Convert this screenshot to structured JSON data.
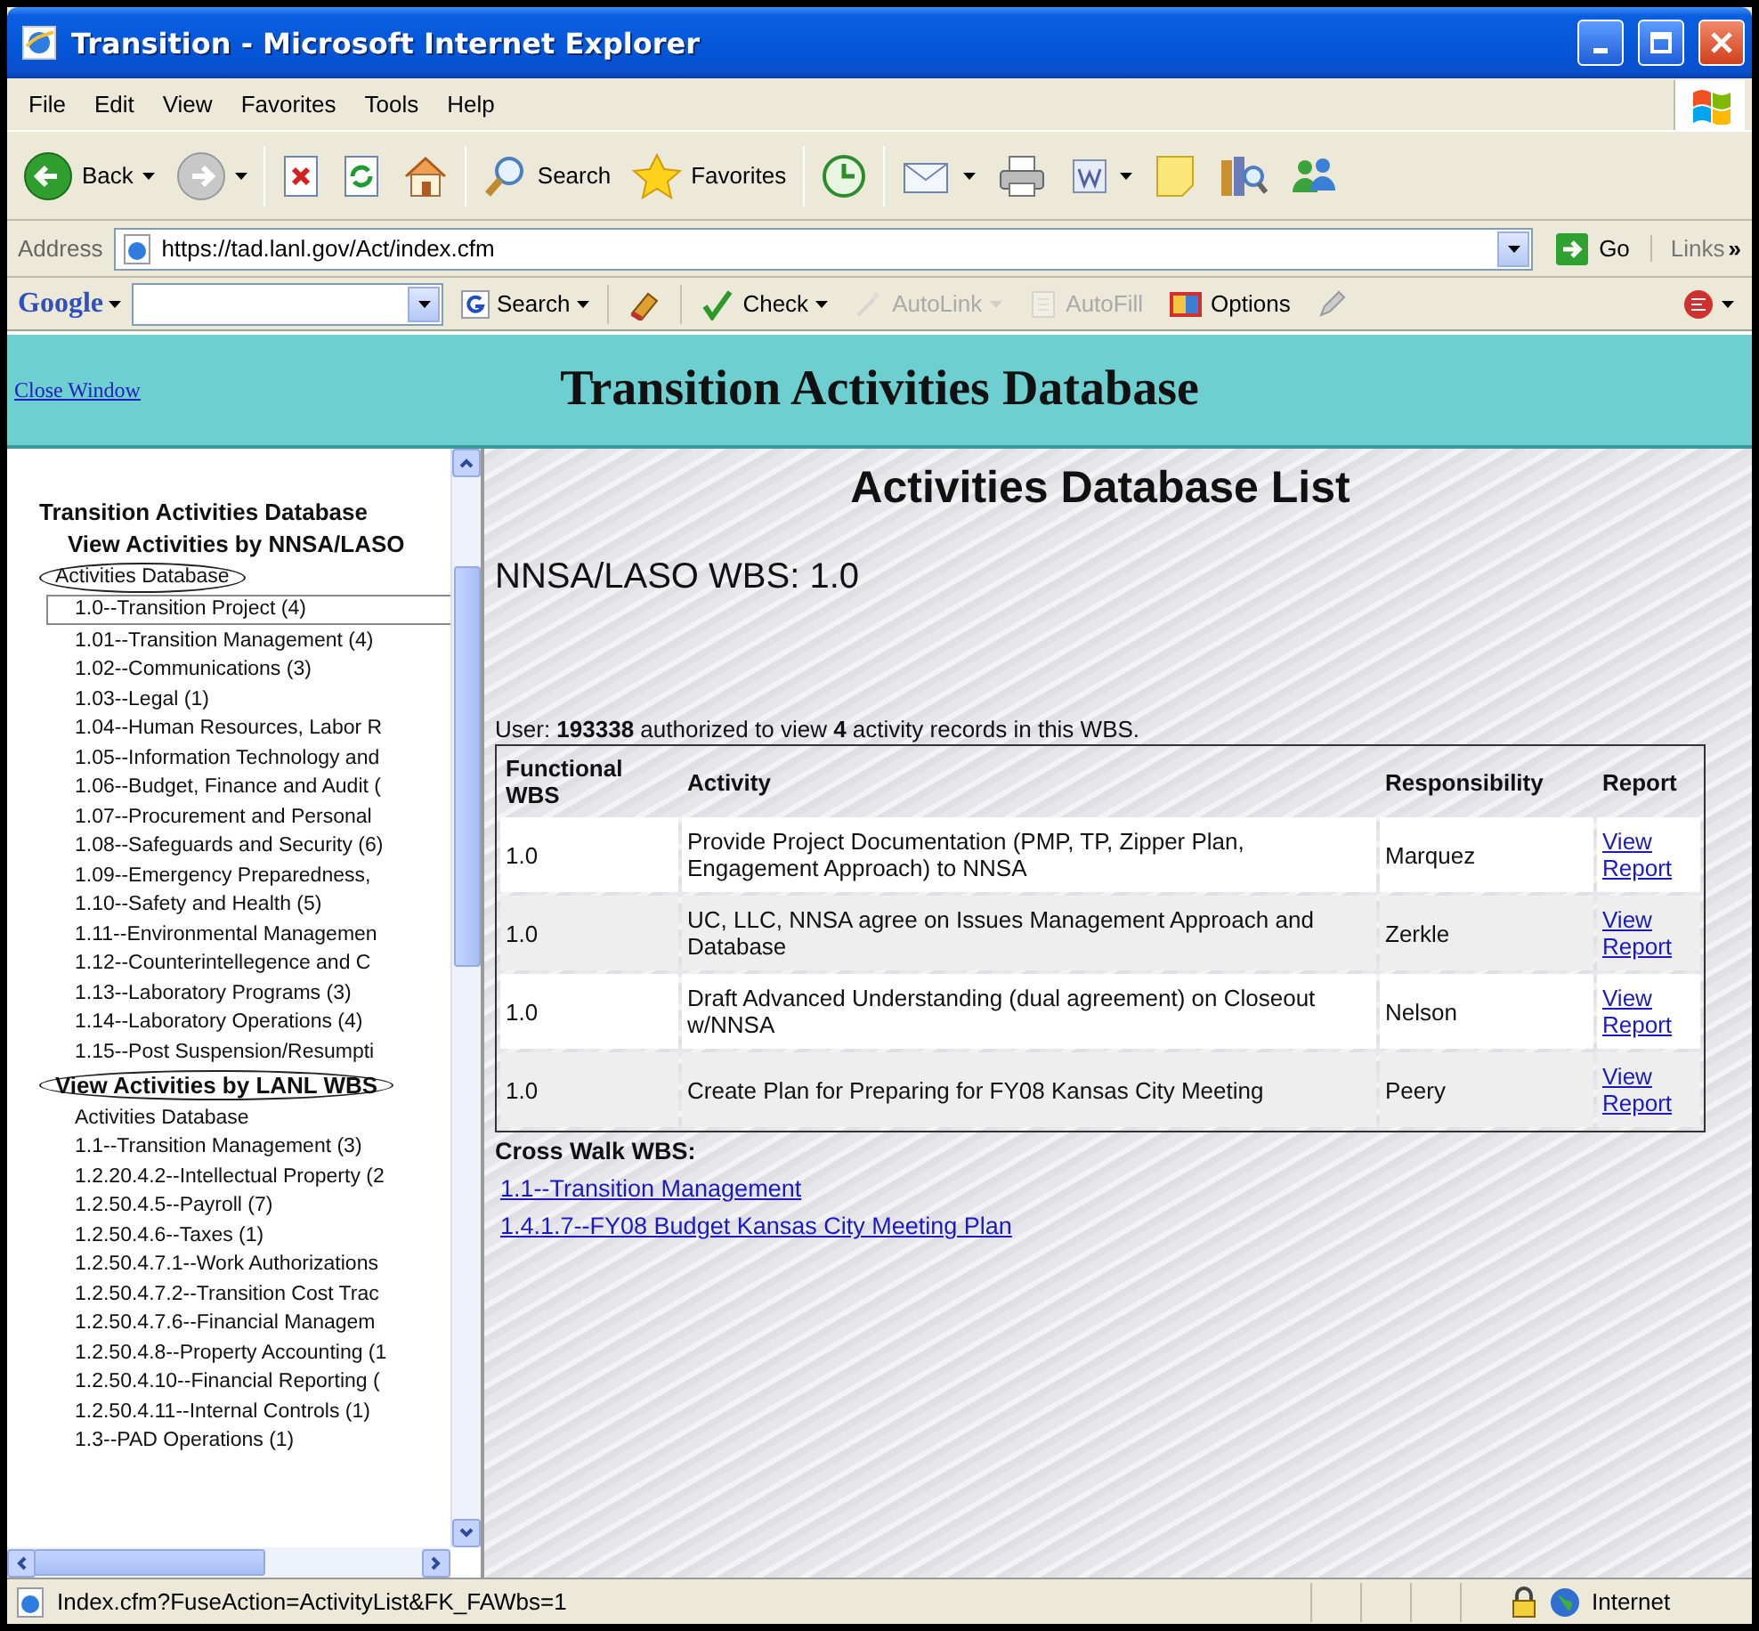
{
  "window": {
    "title": "Transition - Microsoft Internet Explorer"
  },
  "menu": [
    "File",
    "Edit",
    "View",
    "Favorites",
    "Tools",
    "Help"
  ],
  "toolbar": [
    {
      "label": "Back",
      "dropdown": true
    },
    {
      "dropdown": true
    },
    {
      "dropdown": false
    },
    {
      "dropdown": false
    },
    {
      "dropdown": false
    },
    {
      "label": "Search",
      "dropdown": false
    },
    {
      "label": "Favorites",
      "dropdown": false
    },
    {
      "dropdown": false
    },
    {
      "dropdown": true
    },
    {
      "dropdown": false
    },
    {
      "dropdown": true
    },
    {
      "dropdown": false
    },
    {
      "dropdown": false
    },
    {
      "dropdown": false
    }
  ],
  "address": {
    "label": "Address",
    "url": "https://tad.lanl.gov/Act/index.cfm",
    "go": "Go",
    "links": "Links",
    "more": "»"
  },
  "google_bar": {
    "logo": "Google",
    "buttons": [
      {
        "label": "Search",
        "dropdown": true,
        "disabled": false
      },
      {
        "dropdown": false,
        "disabled": false
      },
      {
        "label": "Check",
        "dropdown": true,
        "disabled": false
      },
      {
        "label": "AutoLink",
        "dropdown": true,
        "disabled": true
      },
      {
        "label": "AutoFill",
        "dropdown": false,
        "disabled": true
      },
      {
        "label": "Options",
        "dropdown": false,
        "disabled": false
      },
      {
        "dropdown": false,
        "disabled": false
      }
    ],
    "extra": {
      "dropdown": true
    }
  },
  "header": {
    "close_link": "Close Window",
    "title": "Transition Activities Database"
  },
  "sidebar": {
    "title": "Transition Activities Database",
    "sections": [
      {
        "heading": "View Activities by NNSA/LASO",
        "circled": false,
        "items": [
          {
            "label": "Activities Database",
            "selected": false,
            "circled": true
          },
          {
            "label": "1.0--Transition Project (4)",
            "selected": true,
            "circled": false
          },
          {
            "label": "1.01--Transition Management (4)",
            "selected": false,
            "circled": false
          },
          {
            "label": "1.02--Communications (3)",
            "selected": false,
            "circled": false
          },
          {
            "label": "1.03--Legal (1)",
            "selected": false,
            "circled": false
          },
          {
            "label": "1.04--Human Resources, Labor R",
            "selected": false,
            "circled": false
          },
          {
            "label": "1.05--Information Technology and",
            "selected": false,
            "circled": false
          },
          {
            "label": "1.06--Budget, Finance and Audit (",
            "selected": false,
            "circled": false
          },
          {
            "label": "1.07--Procurement and Personal",
            "selected": false,
            "circled": false
          },
          {
            "label": "1.08--Safeguards and Security (6)",
            "selected": false,
            "circled": false
          },
          {
            "label": "1.09--Emergency Preparedness,",
            "selected": false,
            "circled": false
          },
          {
            "label": "1.10--Safety and Health (5)",
            "selected": false,
            "circled": false
          },
          {
            "label": "1.11--Environmental Managemen",
            "selected": false,
            "circled": false
          },
          {
            "label": "1.12--Counterintellegence and C",
            "selected": false,
            "circled": false
          },
          {
            "label": "1.13--Laboratory Programs (3)",
            "selected": false,
            "circled": false
          },
          {
            "label": "1.14--Laboratory Operations (4)",
            "selected": false,
            "circled": false
          },
          {
            "label": "1.15--Post Suspension/Resumpti",
            "selected": false,
            "circled": false
          }
        ]
      },
      {
        "heading": "View Activities by LANL WBS",
        "circled": true,
        "items": [
          {
            "label": "Activities Database",
            "selected": false,
            "circled": false
          },
          {
            "label": "1.1--Transition Management (3)",
            "selected": false,
            "circled": false
          },
          {
            "label": "1.2.20.4.2--Intellectual Property (2",
            "selected": false,
            "circled": false
          },
          {
            "label": "1.2.50.4.5--Payroll (7)",
            "selected": false,
            "circled": false
          },
          {
            "label": "1.2.50.4.6--Taxes (1)",
            "selected": false,
            "circled": false
          },
          {
            "label": "1.2.50.4.7.1--Work Authorizations",
            "selected": false,
            "circled": false
          },
          {
            "label": "1.2.50.4.7.2--Transition Cost Trac",
            "selected": false,
            "circled": false
          },
          {
            "label": "1.2.50.4.7.6--Financial Managem",
            "selected": false,
            "circled": false
          },
          {
            "label": "1.2.50.4.8--Property Accounting (1",
            "selected": false,
            "circled": false
          },
          {
            "label": "1.2.50.4.10--Financial Reporting (",
            "selected": false,
            "circled": false
          },
          {
            "label": "1.2.50.4.11--Internal Controls (1)",
            "selected": false,
            "circled": false
          },
          {
            "label": "1.3--PAD Operations (1)",
            "selected": false,
            "circled": false
          }
        ]
      }
    ]
  },
  "content": {
    "title": "Activities Database List",
    "wbs": "NNSA/LASO WBS: 1.0",
    "summary": "User: **193338** authorized to view **4** activity records in this WBS.",
    "table": {
      "columns": [
        "Functional WBS",
        "Activity",
        "Responsibility",
        "Report"
      ],
      "rows": [
        {
          "wbs": "1.0",
          "activity": "Provide Project Documentation (PMP, TP, Zipper Plan, Engagement Approach) to NNSA",
          "responsibility": "Marquez",
          "report": "View Report"
        },
        {
          "wbs": "1.0",
          "activity": "UC, LLC, NNSA agree on Issues Management Approach and Database",
          "responsibility": "Zerkle",
          "report": "View Report"
        },
        {
          "wbs": "1.0",
          "activity": "Draft Advanced Understanding (dual agreement) on Closeout w/NNSA",
          "responsibility": "Nelson",
          "report": "View Report"
        },
        {
          "wbs": "1.0",
          "activity": "Create Plan for Preparing for FY08 Kansas City Meeting",
          "responsibility": "Peery",
          "report": "View Report"
        }
      ]
    },
    "crosswalk": {
      "heading": "Cross Walk WBS:",
      "links": [
        "1.1--Transition Management",
        "1.4.1.7--FY08 Budget Kansas City Meeting Plan"
      ]
    }
  },
  "status_bar": {
    "text": "Index.cfm?FuseAction=ActivityList&FK_FAWbs=1",
    "zone": "Internet"
  }
}
